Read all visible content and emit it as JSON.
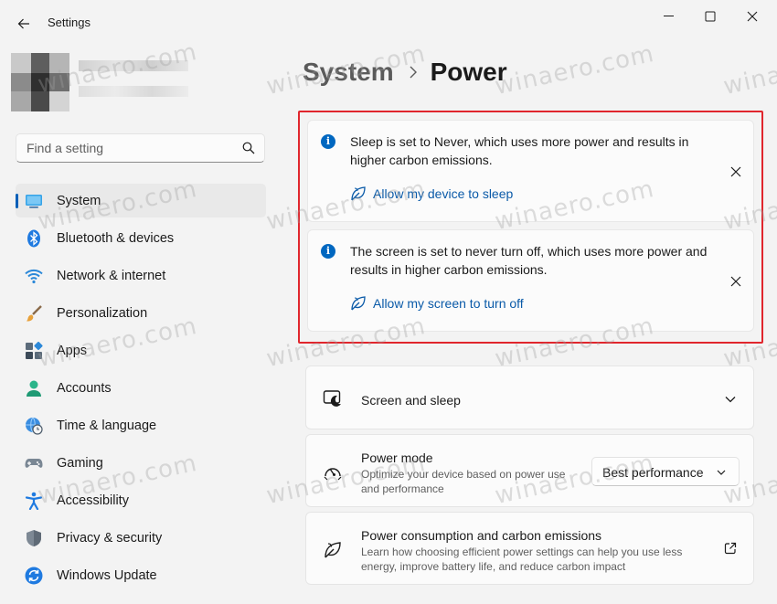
{
  "window": {
    "title": "Settings"
  },
  "search": {
    "placeholder": "Find a setting"
  },
  "nav": [
    {
      "label": "System",
      "icon": "monitor-icon"
    },
    {
      "label": "Bluetooth & devices",
      "icon": "bluetooth-icon"
    },
    {
      "label": "Network & internet",
      "icon": "wifi-icon"
    },
    {
      "label": "Personalization",
      "icon": "brush-icon"
    },
    {
      "label": "Apps",
      "icon": "apps-icon"
    },
    {
      "label": "Accounts",
      "icon": "person-icon"
    },
    {
      "label": "Time & language",
      "icon": "globe-clock-icon"
    },
    {
      "label": "Gaming",
      "icon": "gamepad-icon"
    },
    {
      "label": "Accessibility",
      "icon": "accessibility-icon"
    },
    {
      "label": "Privacy & security",
      "icon": "shield-icon"
    },
    {
      "label": "Windows Update",
      "icon": "update-icon"
    }
  ],
  "header": {
    "parent": "System",
    "current": "Power"
  },
  "info_bars": [
    {
      "text": "Sleep is set to Never, which uses more power and results in higher carbon emissions.",
      "link": "Allow my device to sleep"
    },
    {
      "text": "The screen is set to never turn off, which uses more power and results in higher carbon emissions.",
      "link": "Allow my screen to turn off"
    }
  ],
  "cards": {
    "screen_sleep": {
      "title": "Screen and sleep"
    },
    "power_mode": {
      "title": "Power mode",
      "description": "Optimize your device based on power use and performance",
      "value": "Best performance"
    },
    "consumption": {
      "title": "Power consumption and carbon emissions",
      "description": "Learn how choosing efficient power settings can help you use less energy, improve battery life, and reduce carbon impact"
    }
  },
  "watermark": "winaero.com",
  "colors": {
    "accent": "#005fb8",
    "link": "#0a5aa8",
    "highlight": "#e0262d",
    "info": "#0067c0"
  }
}
